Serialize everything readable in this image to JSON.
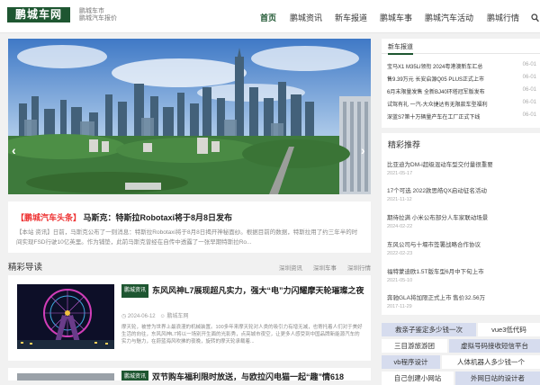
{
  "header": {
    "logo": "鹏城车网",
    "tagline_line1": "鹏城车市",
    "tagline_line2": "鹏城汽车报价",
    "nav": [
      "首页",
      "鹏城资讯",
      "新车报道",
      "鹏城车事",
      "鹏城汽车活动",
      "鹏城行情"
    ],
    "active_nav": "首页",
    "search_icon": "search-icon"
  },
  "slider": {
    "prev": "‹",
    "next": "›",
    "current_dot": 3
  },
  "featured": {
    "tag": "【鹏城汽车头条】",
    "title": "马斯克：特斯拉Robotaxi将于8月8日发布",
    "desc": "【本站 资讯】日前，马斯克公布了一则消息：特斯拉Robotaxi将于8月8日揭开神秘面纱。根据目前的数据，特斯拉用了约三年半的时间实现FSD行驶10亿英里。作为铺垫，此前马斯克曾经在自传中透露了一张早期特斯拉Ro..."
  },
  "guide": {
    "heading": "精彩导读",
    "tabs": [
      "深圳资讯",
      "深圳车事",
      "深圳行情"
    ]
  },
  "articles": [
    {
      "category": "鹏城资讯",
      "title": "东风风神L7展现超凡实力，强大“电”力闪耀摩天轮璀璨之夜",
      "date": "2024-06-12",
      "author": "鹏城车网",
      "desc": "摩天轮，被誉为世界上最浪漫的机械装置。100多年来摩天轮对人类的吸引力有增无减，也寄托着人们对于美好生活的向往，东风风神L7将以一场别开生面的光影秀，点亮城市夜空，让更多人感受到中国品牌新能源汽车的实力与魅力，在蔚蓝海风吹拂的夜晚，旋转的摩天轮承载着..."
    },
    {
      "category": "鹏城资讯",
      "title": "双节购车福利限时放送，与欧拉闪电猫一起“趣”情618"
    }
  ],
  "news_box": {
    "tab": "新车报道",
    "items": [
      {
        "title": "宝马X1 M35Li领衔 2024粤港澳新车汇总",
        "date": "06-01"
      },
      {
        "title": "售9.39万元 长安启源Q05 PLUS正式上市",
        "date": "06-01"
      },
      {
        "title": "6月末限量发售 全新BJ40环塔冠军版发布",
        "date": "06-01"
      },
      {
        "title": "试驾有礼 一汽-大众捷达有无限款车型福利",
        "date": "06-01"
      },
      {
        "title": "深蓝S7第十万辆量产车在工厂正式下线",
        "date": "06-01"
      }
    ]
  },
  "recommend": {
    "heading": "精彩推荐",
    "items": [
      {
        "title": "比亚迪为DM-i超级混动车型交付量很重要",
        "date": "2021-05-17"
      },
      {
        "title": "17个可选 2022款思皓QX启动征名活动",
        "date": "2021-11-12"
      },
      {
        "title": "期待拉满 小米公布部分人车家联动场景",
        "date": "2024-02-22"
      },
      {
        "title": "东风公司与十堰市签署战略合作协议",
        "date": "2022-02-23"
      },
      {
        "title": "福特蒙迪欧1.5T版车型6月中下旬上市",
        "date": "2021-05-10"
      },
      {
        "title": "奔驰GLA将加限正式上市 售价32.56万",
        "date": "2017-11-29"
      }
    ]
  },
  "links": [
    "救亲子鉴定多少钱一次",
    "vue3低代码",
    "三目游旅游团",
    "虚拟号码接收短信平台",
    "vb程序设计",
    "人体机器人多少钱一个",
    "自己创建小网站",
    "外网日站的设计者"
  ],
  "colors": {
    "brand": "#1e5631",
    "headline_tag": "#e33"
  }
}
